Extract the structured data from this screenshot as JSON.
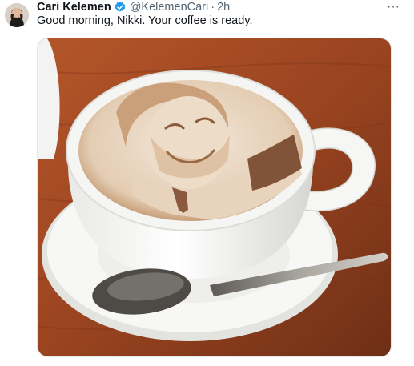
{
  "tweet": {
    "author_name": "Cari Kelemen",
    "handle": "@KelemenCari",
    "separator": "·",
    "time": "2h",
    "text": "Good morning, Nikki. Your coffee is ready.",
    "more_label": "···"
  },
  "icons": {
    "verified": "verified-badge-icon",
    "more": "more-options-icon"
  },
  "colors": {
    "verified": "#1d9bf0",
    "text": "#0f1419",
    "secondary": "#536471"
  }
}
